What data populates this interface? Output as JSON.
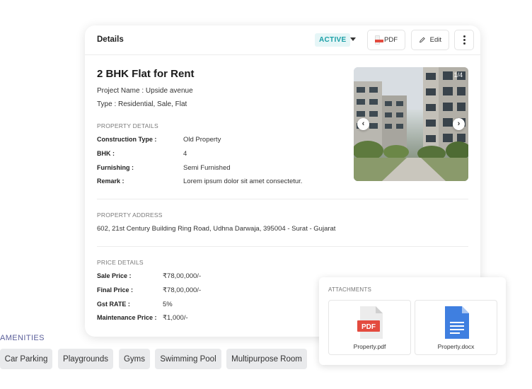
{
  "header": {
    "title": "Details",
    "status": "ACTIVE",
    "pdf_label": "PDF",
    "edit_label": "Edit"
  },
  "listing": {
    "title": "2 BHK Flat for Rent",
    "project_line": "Project Name : Upside avenue",
    "type_line": "Type : Residential, Sale, Flat"
  },
  "property_details": {
    "section_label": "PROPERTY DETAILS",
    "rows": [
      {
        "label": "Construction Type :",
        "value": "Old Property"
      },
      {
        "label": "BHK :",
        "value": "4"
      },
      {
        "label": "Furnishing :",
        "value": "Semi Furnished"
      },
      {
        "label": "Remark :",
        "value": "Lorem ipsum dolor sit amet consectetur."
      }
    ]
  },
  "address": {
    "section_label": "PROPERTY ADDRESS",
    "text": "602, 21st Century Building Ring Road, Udhna Darwaja, 395004 - Surat - Gujarat"
  },
  "price_details": {
    "section_label": "PRICE DETAILS",
    "rows": [
      {
        "label": "Sale Price :",
        "value": "₹78,00,000/-"
      },
      {
        "label": "Final Price :",
        "value": "₹78,00,000/-"
      },
      {
        "label": "Gst RATE :",
        "value": "5%"
      },
      {
        "label": "Maintenance Price :",
        "value": "₹1,000/-"
      }
    ]
  },
  "gallery": {
    "counter": "1/4",
    "prev_icon": "chevron-left-icon",
    "next_icon": "chevron-right-icon"
  },
  "attachments": {
    "section_label": "ATTACHMENTS",
    "files": [
      {
        "name": "Property.pdf",
        "icon": "pdf-file-icon",
        "badge": "PDF"
      },
      {
        "name": "Property.docx",
        "icon": "docx-file-icon"
      }
    ]
  },
  "amenities": {
    "label": "AMENITIES",
    "items": [
      "Car Parking",
      "Playgrounds",
      "Gyms",
      "Swimming Pool",
      "Multipurpose Room"
    ]
  },
  "colors": {
    "status_bg": "#e6f6f7",
    "status_text": "#1a9fa6",
    "pdf_red": "#e34b3f",
    "doc_blue": "#3f7fe0",
    "amenity_label": "#5b5f9a",
    "chip_bg": "#e9eaec"
  }
}
